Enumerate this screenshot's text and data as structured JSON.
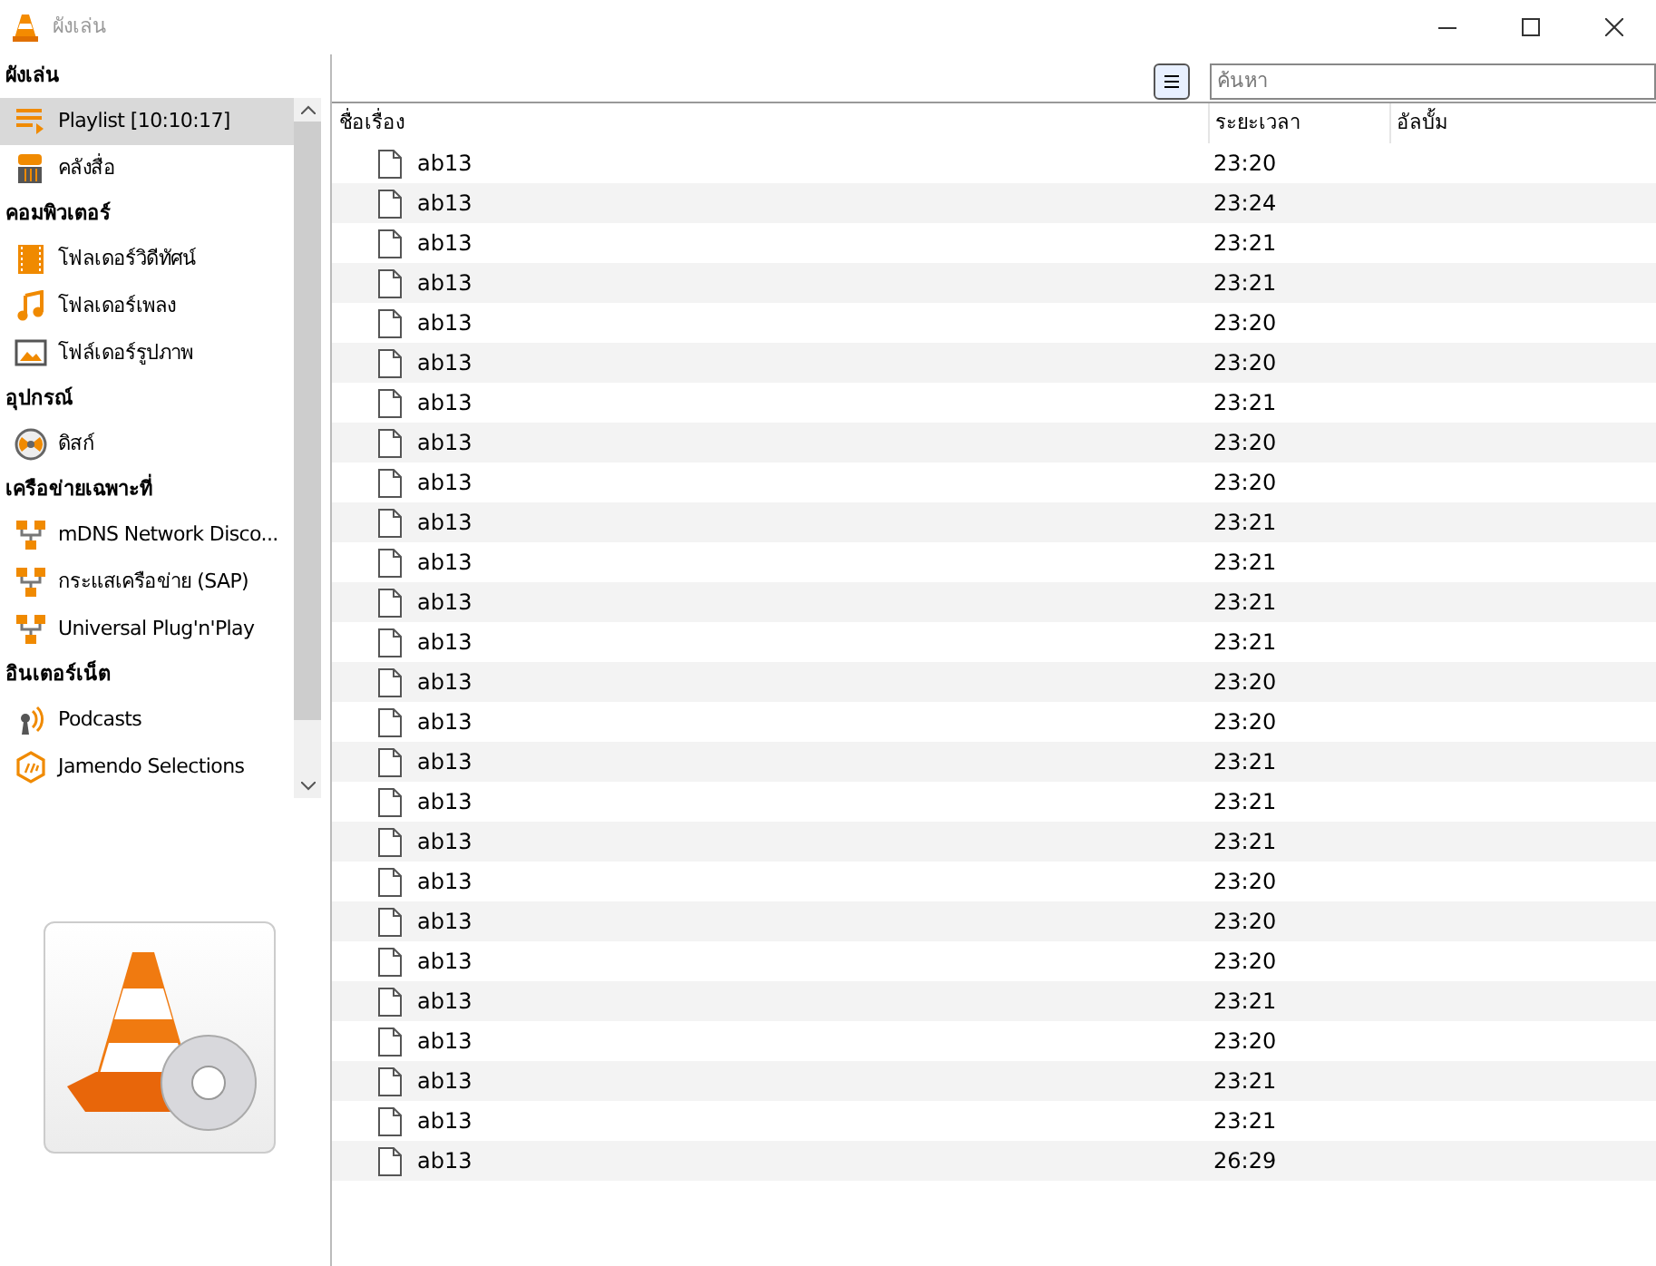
{
  "window": {
    "title": "ผังเล่น"
  },
  "sidebar": {
    "sections": [
      {
        "heading": "ผังเล่น",
        "items": [
          {
            "label": "Playlist [10:10:17]",
            "kind": "playlist",
            "selected": true
          },
          {
            "label": "คลังสื่อ",
            "kind": "library",
            "selected": false
          }
        ]
      },
      {
        "heading": "คอมพิวเตอร์",
        "items": [
          {
            "label": "โฟลเดอร์วิดีทัศน์",
            "kind": "video",
            "selected": false
          },
          {
            "label": "โฟลเดอร์เพลง",
            "kind": "music",
            "selected": false
          },
          {
            "label": "โฟล์เดอร์รูปภาพ",
            "kind": "picture",
            "selected": false
          }
        ]
      },
      {
        "heading": "อุปกรณ์",
        "items": [
          {
            "label": "ดิสก์",
            "kind": "disc",
            "selected": false
          }
        ]
      },
      {
        "heading": "เครือข่ายเฉพาะที่",
        "items": [
          {
            "label": "mDNS Network Disco...",
            "kind": "network",
            "selected": false
          },
          {
            "label": "กระแสเครือข่าย (SAP)",
            "kind": "network",
            "selected": false
          },
          {
            "label": "Universal Plug'n'Play",
            "kind": "network",
            "selected": false
          }
        ]
      },
      {
        "heading": "อินเตอร์เน็ต",
        "items": [
          {
            "label": "Podcasts",
            "kind": "podcast",
            "selected": false
          },
          {
            "label": "Jamendo Selections",
            "kind": "jamendo",
            "selected": false
          }
        ]
      }
    ]
  },
  "search": {
    "placeholder": "ค้นหา"
  },
  "table": {
    "columns": [
      "ชื่อเรื่อง",
      "ระยะเวลา",
      "อัลบั้ม"
    ],
    "rows": [
      {
        "title": "ab13",
        "duration": "23:20"
      },
      {
        "title": "ab13",
        "duration": "23:24"
      },
      {
        "title": "ab13",
        "duration": "23:21"
      },
      {
        "title": "ab13",
        "duration": "23:21"
      },
      {
        "title": "ab13",
        "duration": "23:20"
      },
      {
        "title": "ab13",
        "duration": "23:20"
      },
      {
        "title": "ab13",
        "duration": "23:21"
      },
      {
        "title": "ab13",
        "duration": "23:20"
      },
      {
        "title": "ab13",
        "duration": "23:20"
      },
      {
        "title": "ab13",
        "duration": "23:21"
      },
      {
        "title": "ab13",
        "duration": "23:21"
      },
      {
        "title": "ab13",
        "duration": "23:21"
      },
      {
        "title": "ab13",
        "duration": "23:21"
      },
      {
        "title": "ab13",
        "duration": "23:20"
      },
      {
        "title": "ab13",
        "duration": "23:20"
      },
      {
        "title": "ab13",
        "duration": "23:21"
      },
      {
        "title": "ab13",
        "duration": "23:21"
      },
      {
        "title": "ab13",
        "duration": "23:21"
      },
      {
        "title": "ab13",
        "duration": "23:20"
      },
      {
        "title": "ab13",
        "duration": "23:20"
      },
      {
        "title": "ab13",
        "duration": "23:20"
      },
      {
        "title": "ab13",
        "duration": "23:21"
      },
      {
        "title": "ab13",
        "duration": "23:20"
      },
      {
        "title": "ab13",
        "duration": "23:21"
      },
      {
        "title": "ab13",
        "duration": "23:21"
      },
      {
        "title": "ab13",
        "duration": "26:29"
      }
    ]
  }
}
